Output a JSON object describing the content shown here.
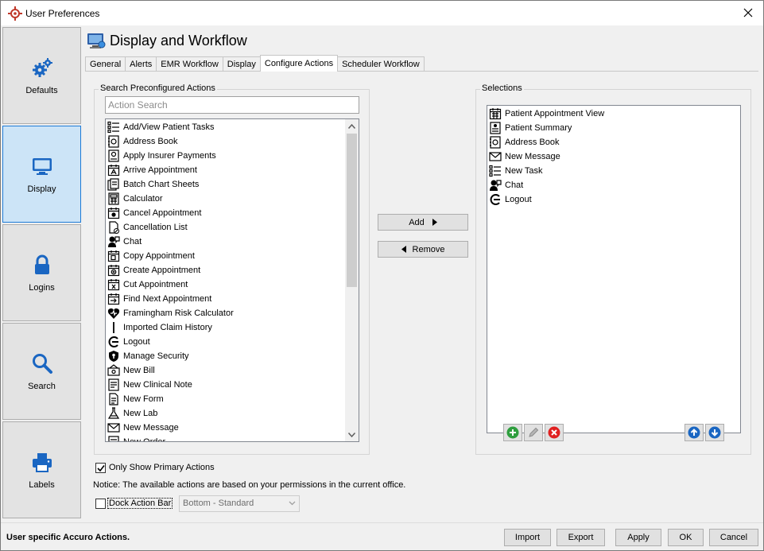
{
  "window": {
    "title": "User Preferences"
  },
  "nav": {
    "items": [
      {
        "label": "Defaults",
        "icon": "gears-icon",
        "active": false
      },
      {
        "label": "Display",
        "icon": "monitor-icon",
        "active": true
      },
      {
        "label": "Logins",
        "icon": "lock-icon",
        "active": false
      },
      {
        "label": "Search",
        "icon": "search-icon",
        "active": false
      },
      {
        "label": "Labels",
        "icon": "printer-icon",
        "active": false
      }
    ]
  },
  "header": {
    "title": "Display and Workflow"
  },
  "tabs": [
    {
      "label": "General",
      "active": false
    },
    {
      "label": "Alerts",
      "active": false
    },
    {
      "label": "EMR Workflow",
      "active": false
    },
    {
      "label": "Display",
      "active": false
    },
    {
      "label": "Configure Actions",
      "active": true
    },
    {
      "label": "Scheduler Workflow",
      "active": false
    }
  ],
  "search_group": {
    "legend": "Search Preconfigured Actions",
    "placeholder": "Action Search",
    "actions": [
      {
        "label": "Add/View Patient Tasks",
        "icon": "task-list-icon"
      },
      {
        "label": "Address Book",
        "icon": "address-book-icon"
      },
      {
        "label": "Apply Insurer Payments",
        "icon": "insurer-payment-icon"
      },
      {
        "label": "Arrive Appointment",
        "icon": "arrive-appointment-icon"
      },
      {
        "label": "Batch Chart Sheets",
        "icon": "chart-sheets-icon"
      },
      {
        "label": "Calculator",
        "icon": "calculator-icon"
      },
      {
        "label": "Cancel Appointment",
        "icon": "cancel-appointment-icon"
      },
      {
        "label": "Cancellation List",
        "icon": "cancellation-list-icon"
      },
      {
        "label": "Chat",
        "icon": "chat-icon"
      },
      {
        "label": "Copy Appointment",
        "icon": "copy-appointment-icon"
      },
      {
        "label": "Create Appointment",
        "icon": "create-appointment-icon"
      },
      {
        "label": "Cut Appointment",
        "icon": "cut-appointment-icon"
      },
      {
        "label": "Find Next Appointment",
        "icon": "find-next-appointment-icon"
      },
      {
        "label": "Framingham Risk Calculator",
        "icon": "heart-icon"
      },
      {
        "label": "Imported Claim History",
        "icon": "claim-history-icon"
      },
      {
        "label": "Logout",
        "icon": "logout-icon"
      },
      {
        "label": "Manage Security",
        "icon": "shield-icon"
      },
      {
        "label": "New Bill",
        "icon": "bill-icon"
      },
      {
        "label": "New Clinical Note",
        "icon": "clinical-note-icon"
      },
      {
        "label": "New Form",
        "icon": "form-icon"
      },
      {
        "label": "New Lab",
        "icon": "flask-icon"
      },
      {
        "label": "New Message",
        "icon": "envelope-icon"
      },
      {
        "label": "New Order",
        "icon": "order-icon"
      }
    ],
    "scroll_position": 0.0
  },
  "selections_group": {
    "legend": "Selections",
    "items": [
      {
        "label": "Patient Appointment View",
        "icon": "calendar-icon"
      },
      {
        "label": "Patient Summary",
        "icon": "patient-summary-icon"
      },
      {
        "label": "Address Book",
        "icon": "address-book-icon"
      },
      {
        "label": "New Message",
        "icon": "envelope-icon"
      },
      {
        "label": "New Task",
        "icon": "task-list-icon"
      },
      {
        "label": "Chat",
        "icon": "chat-icon"
      },
      {
        "label": "Logout",
        "icon": "logout-icon"
      }
    ]
  },
  "buttons": {
    "add": "Add",
    "remove": "Remove",
    "import": "Import",
    "export": "Export",
    "apply": "Apply",
    "ok": "OK",
    "cancel": "Cancel"
  },
  "options": {
    "only_primary_label": "Only Show Primary Actions",
    "only_primary_checked": true,
    "notice": "Notice: The available actions are based on your permissions in the current office.",
    "dock_label": "Dock Action Bar",
    "dock_checked": false,
    "dock_position": "Bottom - Standard"
  },
  "status": {
    "text": "User specific Accuro Actions."
  },
  "colors": {
    "accent": "#1e7bd6",
    "nav_active_bg": "#cce4f7",
    "add_green": "#2e9e3e",
    "delete_red": "#e02020",
    "arrow_blue": "#1a66c2"
  }
}
